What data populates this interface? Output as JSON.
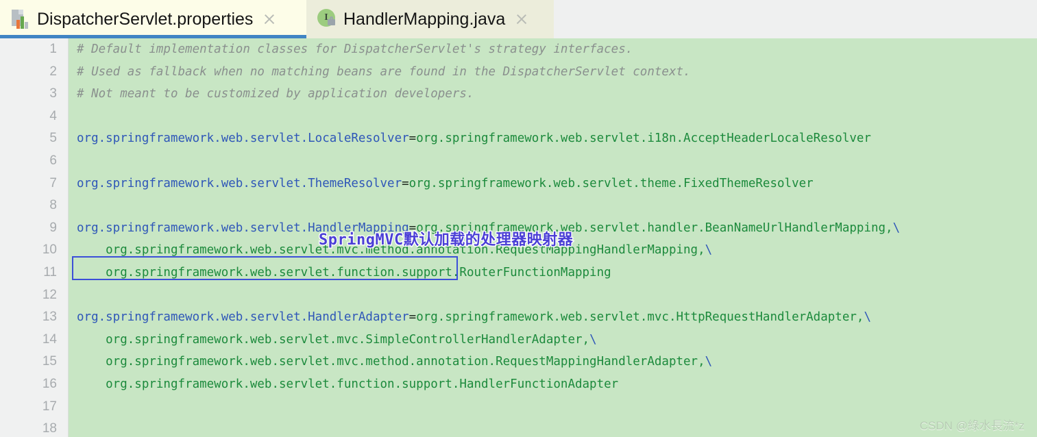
{
  "tabs": [
    {
      "label": "DispatcherServlet.properties",
      "icon": "properties-file-icon",
      "icon_letter": "",
      "active": true,
      "close_label": "×"
    },
    {
      "label": "HandlerMapping.java",
      "icon": "java-interface-icon",
      "icon_letter": "I",
      "active": false,
      "close_label": "×"
    }
  ],
  "editor": {
    "language": "properties",
    "background": "#c8e6c4",
    "gutter_background": "#f0f1f1",
    "line_numbers": [
      "1",
      "2",
      "3",
      "4",
      "5",
      "6",
      "7",
      "8",
      "9",
      "10",
      "11",
      "12",
      "13",
      "14",
      "15",
      "16",
      "17",
      "18"
    ],
    "lines": [
      {
        "n": "1",
        "type": "comment",
        "text": "# Default implementation classes for DispatcherServlet's strategy interfaces."
      },
      {
        "n": "2",
        "type": "comment",
        "text": "# Used as fallback when no matching beans are found in the DispatcherServlet context."
      },
      {
        "n": "3",
        "type": "comment",
        "text": "# Not meant to be customized by application developers."
      },
      {
        "n": "4",
        "type": "blank",
        "text": ""
      },
      {
        "n": "5",
        "type": "pair",
        "key": "org.springframework.web.servlet.LocaleResolver",
        "eq": "=",
        "value": "org.springframework.web.servlet.i18n.AcceptHeaderLocaleResolver",
        "cont": ""
      },
      {
        "n": "6",
        "type": "blank",
        "text": ""
      },
      {
        "n": "7",
        "type": "pair",
        "key": "org.springframework.web.servlet.ThemeResolver",
        "eq": "=",
        "value": "org.springframework.web.servlet.theme.FixedThemeResolver",
        "cont": ""
      },
      {
        "n": "8",
        "type": "blank",
        "text": ""
      },
      {
        "n": "9",
        "type": "pair",
        "key": "org.springframework.web.servlet.HandlerMapping",
        "eq": "=",
        "value": "org.springframework.web.servlet.handler.BeanNameUrlHandlerMapping,",
        "cont": "\\"
      },
      {
        "n": "10",
        "type": "cont",
        "text": "    org.springframework.web.servlet.mvc.method.annotation.RequestMappingHandlerMapping,",
        "cont": "\\"
      },
      {
        "n": "11",
        "type": "cont",
        "text": "    org.springframework.web.servlet.function.support.RouterFunctionMapping",
        "cont": ""
      },
      {
        "n": "12",
        "type": "blank",
        "text": ""
      },
      {
        "n": "13",
        "type": "pair",
        "key": "org.springframework.web.servlet.HandlerAdapter",
        "eq": "=",
        "value": "org.springframework.web.servlet.mvc.HttpRequestHandlerAdapter,",
        "cont": "\\"
      },
      {
        "n": "14",
        "type": "cont",
        "text": "    org.springframework.web.servlet.mvc.SimpleControllerHandlerAdapter,",
        "cont": "\\"
      },
      {
        "n": "15",
        "type": "cont",
        "text": "    org.springframework.web.servlet.mvc.method.annotation.RequestMappingHandlerAdapter,",
        "cont": "\\"
      },
      {
        "n": "16",
        "type": "cont",
        "text": "    org.springframework.web.servlet.function.support.HandlerFunctionAdapter",
        "cont": ""
      },
      {
        "n": "17",
        "type": "blank",
        "text": ""
      },
      {
        "n": "18",
        "type": "blank",
        "text": ""
      }
    ]
  },
  "annotation": {
    "text": "SpringMVC默认加载的处理器映射器",
    "color": "#4b3fd6",
    "outline": "#ffffff"
  },
  "highlight_box": {
    "target_text": "org.springframework.web.servlet.HandlerMapping",
    "color": "#3c4fd8"
  },
  "watermark": {
    "text": "CSDN @綠水長流*z",
    "color": "#b7cdb4"
  },
  "colors": {
    "comment": "#8a908e",
    "key": "#2f57b8",
    "value": "#1c8a3c",
    "equals": "#1f2b1f",
    "tab_active_bg": "#fdfde8",
    "tab_inactive_bg": "#eceddb",
    "tab_underline": "#4185c4",
    "line_number": "#a7abae"
  }
}
